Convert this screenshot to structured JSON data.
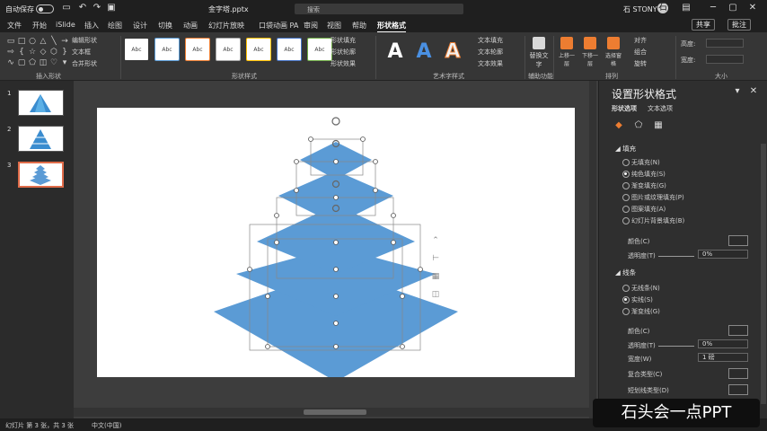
{
  "titlebar": {
    "autosave": "自动保存",
    "toggle_state": "关",
    "filename": "金字塔.pptx",
    "search_placeholder": "搜索",
    "user": "石 STONY",
    "user_initials": "石"
  },
  "tabs": [
    "文件",
    "开始",
    "iSlide",
    "插入",
    "绘图",
    "设计",
    "切换",
    "动画",
    "幻灯片放映",
    "口袋动画 PA",
    "审阅",
    "视图",
    "帮助",
    "形状格式"
  ],
  "share_label": "共享",
  "comment_label": "批注",
  "ribbon": {
    "group_insert_shapes": "插入形状",
    "edit_shape": "编辑形状",
    "text_box": "文本框",
    "merge_shapes": "合并形状",
    "group_shape_styles": "形状样式",
    "shape_fill": "形状填充",
    "shape_outline": "形状轮廓",
    "shape_effects": "形状效果",
    "group_wordart": "艺术字样式",
    "text_fill": "文本填充",
    "text_outline": "文本轮廓",
    "text_effects": "文本效果",
    "alt_text": "替换文字",
    "group_accessibility": "辅助功能",
    "bring_forward": "上移一层",
    "send_backward": "下移一层",
    "selection_pane": "选择窗格",
    "align": "对齐",
    "group": "组合",
    "rotate": "旋转",
    "group_arrange": "排列",
    "height": "高度:",
    "width": "宽度:",
    "group_size": "大小",
    "style_label": "Abc",
    "wordart_letter": "A"
  },
  "slides": [
    {
      "number": "1"
    },
    {
      "number": "2"
    },
    {
      "number": "3"
    }
  ],
  "pane": {
    "title": "设置形状格式",
    "tab_shape": "形状选项",
    "tab_text": "文本选项",
    "fill_section": "填充",
    "fill_options": [
      "无填充(N)",
      "纯色填充(S)",
      "渐变填充(G)",
      "图片或纹理填充(P)",
      "图案填充(A)",
      "幻灯片背景填充(B)"
    ],
    "fill_selected_index": 1,
    "color_label": "颜色(C)",
    "transparency_label": "透明度(T)",
    "transparency_value": "0%",
    "line_section": "线条",
    "line_options": [
      "无线条(N)",
      "实线(S)",
      "渐变线(G)"
    ],
    "line_selected_index": 1,
    "line_color_label": "颜色(C)",
    "line_transparency_label": "透明度(T)",
    "line_transparency_value": "0%",
    "width_label": "宽度(W)",
    "width_value": "1 磅",
    "compound_label": "复合类型(C)",
    "dash_label": "短划线类型(D)"
  },
  "status": {
    "slide_info": "幻灯片 第 3 张，共 3 张",
    "language": "中文(中国)"
  },
  "watermark": "石头会一点PPT",
  "colors": {
    "pyramid_fill": "#5b9bd5",
    "selected_thumb": "#e06c4a",
    "ribbon_bg": "#363636"
  }
}
